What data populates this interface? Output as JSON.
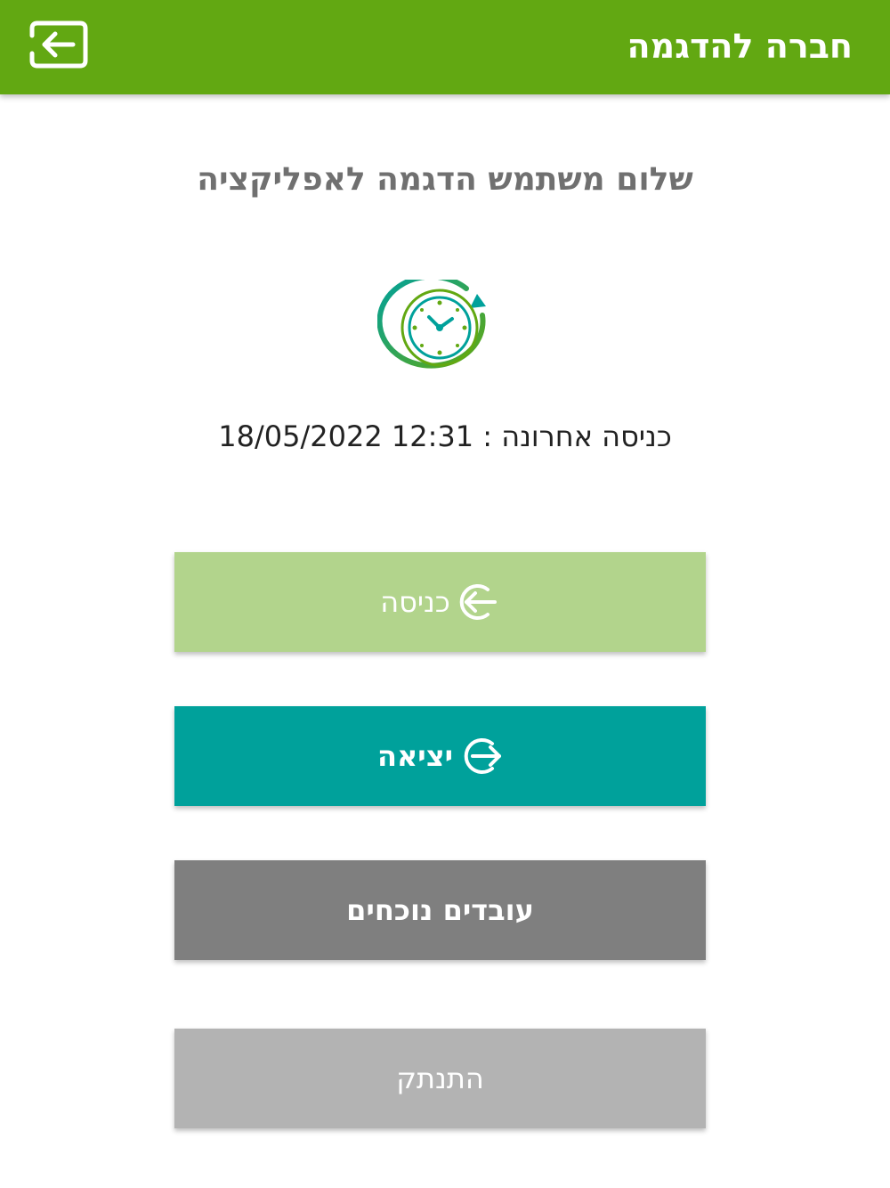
{
  "header": {
    "title": "חברה להדגמה",
    "logout_icon": "exit-door-icon"
  },
  "greeting": "שלום משתמש הדגמה לאפליקציה",
  "clock_icon": "clock-icon",
  "last_login": {
    "label": "כניסה אחרונה :",
    "value": "12:31 18/05/2022"
  },
  "buttons": {
    "checkin": {
      "label": "כניסה",
      "icon": "enter-arrow-icon"
    },
    "checkout": {
      "label": "יציאה",
      "icon": "exit-arrow-icon"
    },
    "present": {
      "label": "עובדים נוכחים"
    },
    "disconnect": {
      "label": "התנתק"
    }
  },
  "colors": {
    "header": "#62a812",
    "checkin": "#b2d48c",
    "checkout": "#00a19b",
    "present": "#7f7f7f",
    "disconnect": "#b3b3b3"
  }
}
